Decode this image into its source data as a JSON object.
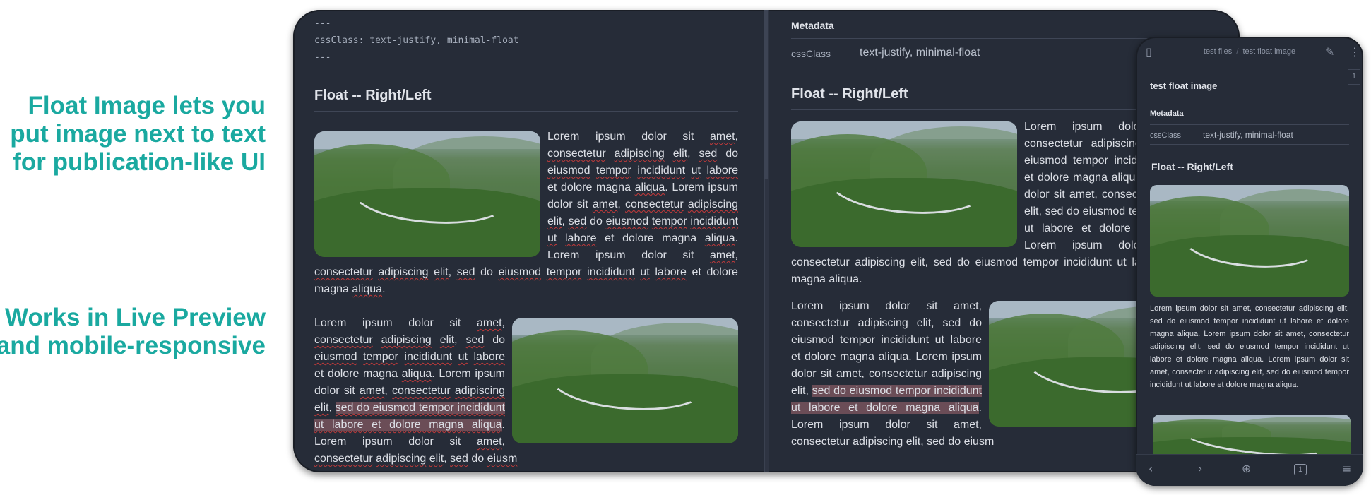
{
  "promo": {
    "caption1_line1": "Float Image lets you",
    "caption1_line2": "put image next to text",
    "caption1_line3": "for publication-like UI",
    "caption2_line1": "Works in Live Preview",
    "caption2_line2": "and mobile-responsive"
  },
  "editor": {
    "frontmatter_open": "---",
    "frontmatter_line": "cssClass: text-justify, minimal-float",
    "frontmatter_close": "---",
    "heading": "Float -- Right/Left",
    "para1": {
      "segments": [
        {
          "t": "Lorem ipsum dolor sit "
        },
        {
          "t": "amet",
          "s": 1
        },
        {
          "t": ", "
        },
        {
          "t": "consectetur",
          "s": 1
        },
        {
          "t": " "
        },
        {
          "t": "adipiscing",
          "s": 1
        },
        {
          "t": " "
        },
        {
          "t": "elit",
          "s": 1
        },
        {
          "t": ", "
        },
        {
          "t": "sed",
          "s": 1
        },
        {
          "t": " do "
        },
        {
          "t": "eiusmod",
          "s": 1
        },
        {
          "t": " "
        },
        {
          "t": "tempor",
          "s": 1
        },
        {
          "t": " "
        },
        {
          "t": "incididunt",
          "s": 1
        },
        {
          "t": " "
        },
        {
          "t": "ut",
          "s": 1
        },
        {
          "t": " "
        },
        {
          "t": "labore",
          "s": 1
        },
        {
          "t": " et dolore magna "
        },
        {
          "t": "aliqua",
          "s": 1
        },
        {
          "t": ". Lorem ipsum dolor sit "
        },
        {
          "t": "amet",
          "s": 1
        },
        {
          "t": ", "
        },
        {
          "t": "consectetur",
          "s": 1
        },
        {
          "t": " "
        },
        {
          "t": "adipiscing",
          "s": 1
        },
        {
          "t": " "
        },
        {
          "t": "elit",
          "s": 1
        },
        {
          "t": ", "
        },
        {
          "t": "sed",
          "s": 1
        },
        {
          "t": " do "
        },
        {
          "t": "eiusmod",
          "s": 1
        },
        {
          "t": " "
        },
        {
          "t": "tempor",
          "s": 1
        },
        {
          "t": " "
        },
        {
          "t": "incididunt",
          "s": 1
        },
        {
          "t": " "
        },
        {
          "t": "ut",
          "s": 1
        },
        {
          "t": " "
        },
        {
          "t": "labore",
          "s": 1
        },
        {
          "t": " et dolore magna "
        },
        {
          "t": "aliqua",
          "s": 1
        },
        {
          "t": ". Lorem ipsum dolor sit "
        },
        {
          "t": "amet",
          "s": 1
        },
        {
          "t": ", "
        },
        {
          "t": "consectetur",
          "s": 1
        },
        {
          "t": " "
        },
        {
          "t": "adipiscing",
          "s": 1
        },
        {
          "t": " "
        },
        {
          "t": "elit",
          "s": 1
        },
        {
          "t": ", "
        },
        {
          "t": "sed",
          "s": 1
        },
        {
          "t": " do "
        },
        {
          "t": "eiusmod",
          "s": 1
        },
        {
          "t": " "
        },
        {
          "t": "tempor",
          "s": 1
        },
        {
          "t": " "
        },
        {
          "t": "incididunt",
          "s": 1
        },
        {
          "t": " "
        },
        {
          "t": "ut",
          "s": 1
        },
        {
          "t": " "
        },
        {
          "t": "labore",
          "s": 1
        },
        {
          "t": " et dolore magna "
        },
        {
          "t": "aliqua",
          "s": 1
        },
        {
          "t": "."
        }
      ]
    },
    "para2": {
      "segments": [
        {
          "t": "Lorem ipsum dolor sit "
        },
        {
          "t": "amet",
          "s": 1
        },
        {
          "t": ", "
        },
        {
          "t": "consectetur",
          "s": 1
        },
        {
          "t": " "
        },
        {
          "t": "adipiscing",
          "s": 1
        },
        {
          "t": " "
        },
        {
          "t": "elit",
          "s": 1
        },
        {
          "t": ", "
        },
        {
          "t": "sed",
          "s": 1
        },
        {
          "t": " do "
        },
        {
          "t": "eiusmod",
          "s": 1
        },
        {
          "t": " "
        },
        {
          "t": "tempor",
          "s": 1
        },
        {
          "t": " "
        },
        {
          "t": "incididunt",
          "s": 1
        },
        {
          "t": " "
        },
        {
          "t": "ut",
          "s": 1
        },
        {
          "t": " "
        },
        {
          "t": "labore",
          "s": 1
        },
        {
          "t": " et dolore magna "
        },
        {
          "t": "aliqua",
          "s": 1
        },
        {
          "t": ". Lorem ipsum dolor sit "
        },
        {
          "t": "amet",
          "s": 1
        },
        {
          "t": ", "
        },
        {
          "t": "consectetur",
          "s": 1
        },
        {
          "t": " "
        },
        {
          "t": "adipiscing",
          "s": 1
        },
        {
          "t": " "
        },
        {
          "t": "elit",
          "s": 1
        },
        {
          "t": ", "
        },
        {
          "t": "sed do eiusmod tempor incididunt ut labore et dolore magna aliqua",
          "s": 1,
          "h": 1
        },
        {
          "t": ". Lorem ipsum dolor sit "
        },
        {
          "t": "amet",
          "s": 1
        },
        {
          "t": ", "
        },
        {
          "t": "consectetur",
          "s": 1
        },
        {
          "t": " "
        },
        {
          "t": "adipiscing",
          "s": 1
        },
        {
          "t": " "
        },
        {
          "t": "elit",
          "s": 1
        },
        {
          "t": ", "
        },
        {
          "t": "sed",
          "s": 1
        },
        {
          "t": " do "
        },
        {
          "t": "eiusm",
          "s": 1
        }
      ]
    }
  },
  "preview": {
    "metadata_title": "Metadata",
    "meta_key": "cssClass",
    "meta_value": "text-justify, minimal-float",
    "heading": "Float -- Right/Left",
    "para1": {
      "segments": [
        {
          "t": "Lorem ipsum dolor sit amet, consectetur adipiscing elit, sed do eiusmod tempor incididunt ut labore et dolore magna aliqua. Lorem ipsum dolor sit amet, consectetur adipiscing elit, sed do eiusmod tempor incididunt ut labore et dolore magna aliqua. Lorem ipsum dolor sit amet, consectetur adipiscing elit, sed do eiusmod tempor incididunt ut labore et dolore magna aliqua."
        }
      ]
    },
    "para2": {
      "segments": [
        {
          "t": "Lorem ipsum dolor sit amet, consectetur adipiscing elit, sed do eiusmod tempor incididunt ut labore et dolore magna aliqua. Lorem ipsum dolor sit amet, consectetur adipiscing elit, "
        },
        {
          "t": "sed do eiusmod tempor incididunt ut labore et dolore magna aliqua",
          "h": 1
        },
        {
          "t": ". Lorem ipsum dolor sit amet, consectetur adipiscing elit, sed do eiusm"
        }
      ]
    }
  },
  "phone": {
    "breadcrumb_folder": "test files",
    "breadcrumb_sep": "/",
    "breadcrumb_file": "test float image",
    "title": "test float image",
    "metadata_title": "Metadata",
    "meta_key": "cssClass",
    "meta_value": "text-justify, minimal-float",
    "heading": "Float -- Right/Left",
    "paragraph": "Lorem ipsum dolor sit amet, consectetur adipiscing elit, sed do eiusmod tempor incididunt ut labore et dolore magna aliqua. Lorem ipsum dolor sit amet, consectetur adipiscing elit, sed do eiusmod tempor incididunt ut labore et dolore magna aliqua. Lorem ipsum dolor sit amet, consectetur adipiscing elit, sed do eiusmod tempor incididunt ut labore et dolore magna aliqua.",
    "side_tab": "1",
    "tab_count": "1",
    "icons": {
      "sidebar": "sidebar-toggle-icon",
      "edit": "pencil-icon",
      "more": "more-vertical-icon",
      "back": "chevron-left-icon",
      "forward": "chevron-right-icon",
      "new": "plus-circle-icon",
      "tabs": "tabs-icon",
      "menu": "menu-icon"
    }
  },
  "colors": {
    "accent": "#1aa9a0",
    "background": "#262c38",
    "spellcheck": "#c23a3a",
    "highlight": "#6b4d57"
  }
}
